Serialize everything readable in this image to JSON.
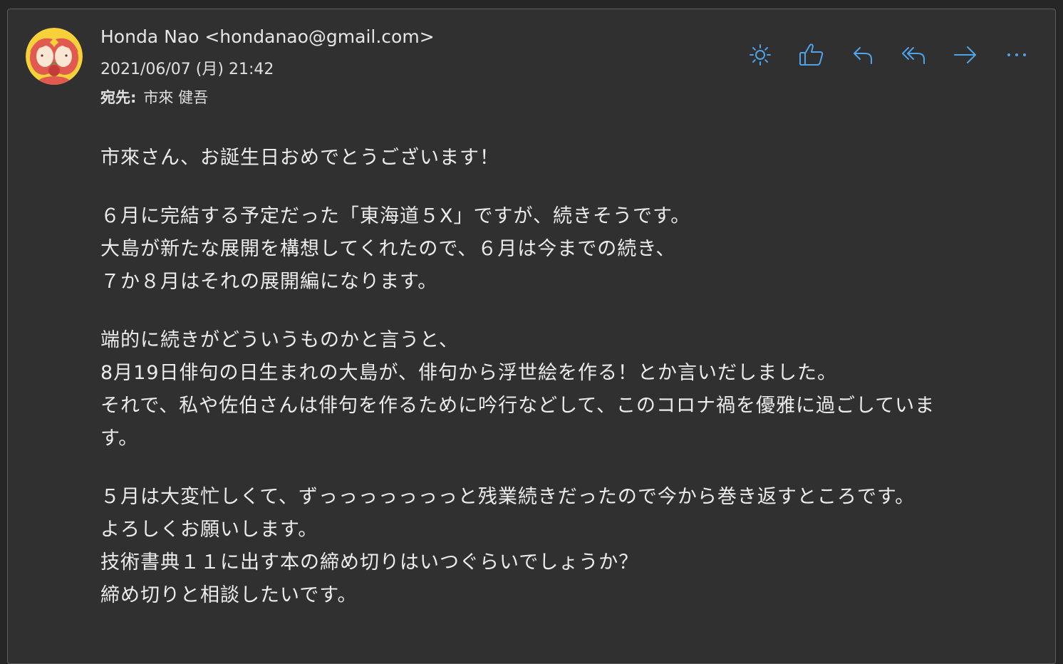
{
  "header": {
    "from": "Honda Nao <hondanao@gmail.com>",
    "date": "2021/06/07 (月) 21:42",
    "to_label": "宛先:",
    "to_value": "市來 健吾"
  },
  "toolbar": {
    "icons": [
      "sun-icon",
      "thumbs-up-icon",
      "reply-icon",
      "reply-all-icon",
      "forward-icon",
      "more-icon"
    ],
    "accent_color": "#4fa3ea"
  },
  "body": {
    "paragraphs": [
      [
        "市來さん、お誕生日おめでとうございます！"
      ],
      [
        "６月に完結する予定だった「東海道５X」ですが、続きそうです。",
        "大島が新たな展開を構想してくれたので、６月は今までの続き、",
        "７か８月はそれの展開編になります。"
      ],
      [
        "端的に続きがどういうものかと言うと、",
        "8月19日俳句の日生まれの大島が、俳句から浮世絵を作る！とか言いだしました。",
        "それで、私や佐伯さんは俳句を作るために吟行などして、このコロナ禍を優雅に過ごしていま",
        "す。"
      ],
      [
        "５月は大変忙しくて、ずっっっっっっっと残業続きだったので今から巻き返すところです。",
        "よろしくお願いします。",
        "技術書典１１に出す本の締め切りはいつぐらいでしょうか？",
        "締め切りと相談したいです。"
      ]
    ]
  }
}
